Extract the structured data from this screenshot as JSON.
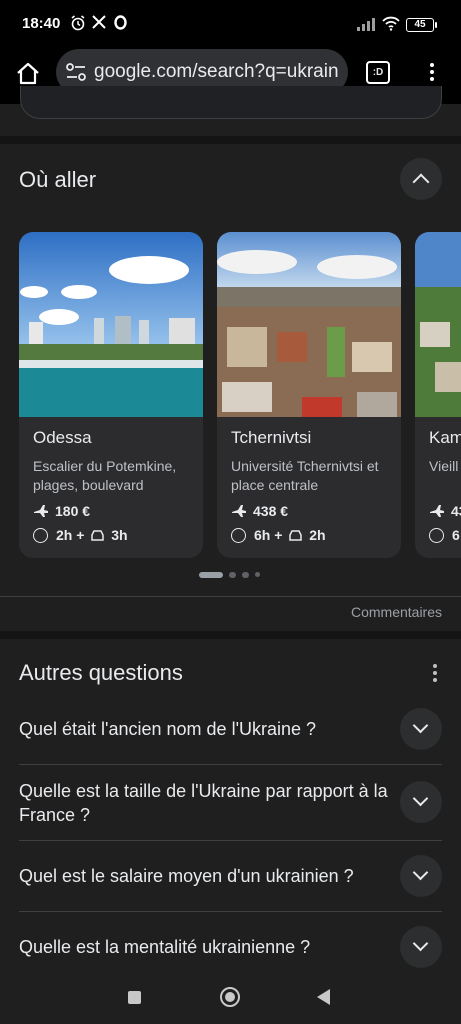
{
  "status": {
    "time": "18:40",
    "battery": "45"
  },
  "toolbar": {
    "url": "google.com/search?q=ukrain",
    "tabs_label": ":D"
  },
  "where_to_go": {
    "title": "Où aller",
    "cards": [
      {
        "name": "Odessa",
        "desc": "Escalier du Potemkine, plages, boulevard",
        "price": "180 €",
        "duration": "2h +",
        "drive": "3h"
      },
      {
        "name": "Tchernivtsi",
        "desc": "Université Tchernivtsi et place centrale",
        "price": "438 €",
        "duration": "6h +",
        "drive": "2h"
      },
      {
        "name": "Kam",
        "desc": "Vieill",
        "price": "43",
        "duration": "6"
      }
    ],
    "feedback": "Commentaires"
  },
  "other_questions": {
    "title": "Autres questions",
    "items": [
      "Quel était l'ancien nom de l'Ukraine ?",
      "Quelle est la taille de l'Ukraine par rapport à la France ?",
      "Quel est le salaire moyen d'un ukrainien ?",
      "Quelle est la mentalité ukrainienne ?"
    ]
  },
  "colors": {
    "background": "#1f1f1f",
    "card": "#2c2c2e",
    "text": "#e8eaed"
  },
  "icons": [
    "alarm-icon",
    "x-logo-icon",
    "opera-icon",
    "signal-icon",
    "wifi-icon",
    "home-icon",
    "tune-icon",
    "tabs-icon",
    "menu-icon",
    "plane-icon",
    "clock-icon",
    "car-icon"
  ]
}
